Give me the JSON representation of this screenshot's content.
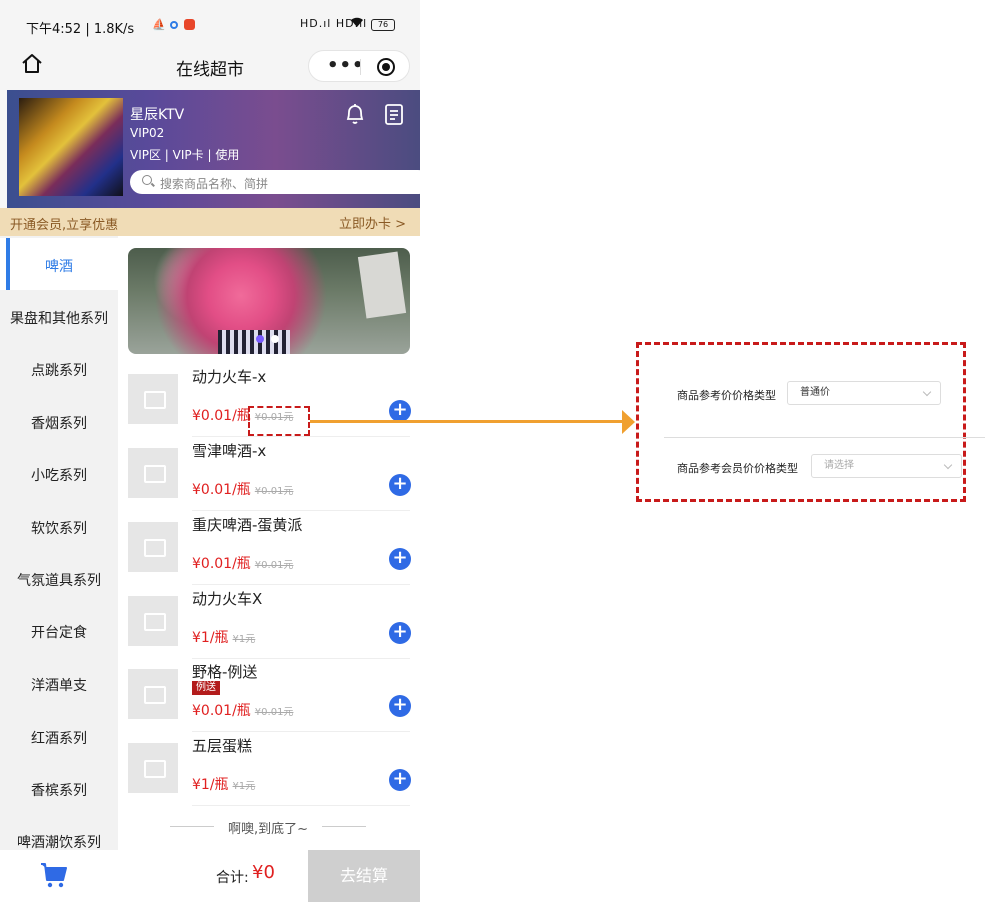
{
  "status_bar": {
    "time": "下午4:52 | 1.8K/s",
    "signal": "HD.ıl HD.ıl",
    "battery": "76"
  },
  "nav": {
    "title": "在线超市",
    "more": "•••"
  },
  "shop": {
    "name": "星辰KTV",
    "room": "VIP02",
    "info": "VIP区 | VIP卡 | 使用",
    "search_placeholder": "搜索商品名称、简拼"
  },
  "member_bar": {
    "left": "开通会员,立享优惠",
    "right": "立即办卡 >"
  },
  "sidebar": {
    "items": [
      {
        "label": "啤酒",
        "active": true
      },
      {
        "label": "果盘和其他系列"
      },
      {
        "label": "点跳系列"
      },
      {
        "label": "香烟系列"
      },
      {
        "label": "小吃系列"
      },
      {
        "label": "软饮系列"
      },
      {
        "label": "气氛道具系列"
      },
      {
        "label": "开台定食"
      },
      {
        "label": "洋酒单支"
      },
      {
        "label": "红酒系列"
      },
      {
        "label": "香槟系列"
      },
      {
        "label": "啤酒潮饮系列"
      }
    ]
  },
  "products": [
    {
      "name": "动力火车-x",
      "price": "¥0.01/瓶",
      "orig": "¥0.01元",
      "tag": ""
    },
    {
      "name": "雪津啤酒-x",
      "price": "¥0.01/瓶",
      "orig": "¥0.01元",
      "tag": ""
    },
    {
      "name": "重庆啤酒-蛋黄派",
      "price": "¥0.01/瓶",
      "orig": "¥0.01元",
      "tag": ""
    },
    {
      "name": "动力火车X",
      "price": "¥1/瓶",
      "orig": "¥1元",
      "tag": ""
    },
    {
      "name": "野格-例送",
      "price": "¥0.01/瓶",
      "orig": "¥0.01元",
      "tag": "例送"
    },
    {
      "name": "五层蛋糕",
      "price": "¥1/瓶",
      "orig": "¥1元",
      "tag": ""
    }
  ],
  "list_end": "啊噢,到底了~",
  "cart": {
    "total_label": "合计:",
    "total_value": "¥0",
    "checkout": "去结算"
  },
  "detail_panel": {
    "row1_label": "商品参考价价格类型",
    "row1_value": "普通价",
    "row2_label": "商品参考会员价价格类型",
    "row2_placeholder": "请选择"
  },
  "colors": {
    "accent": "#2f7ce6",
    "price": "#e02020",
    "annotation": "#c81a1a",
    "arrow": "#f0a030"
  }
}
